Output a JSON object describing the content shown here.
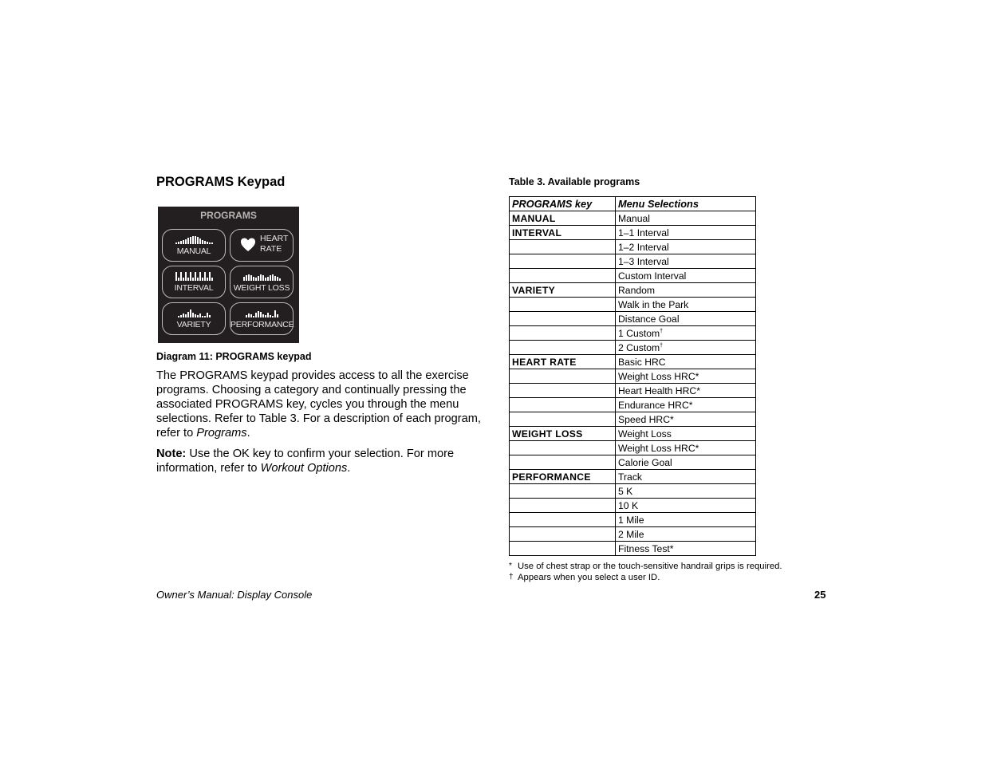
{
  "section": {
    "title": "PROGRAMS Keypad"
  },
  "keypad": {
    "title": "PROGRAMS",
    "buttons": [
      {
        "label": "MANUAL",
        "icon": "manual-profile-bars-icon"
      },
      {
        "label_line1": "HEART",
        "label_line2": "RATE",
        "icon": "heart-icon"
      },
      {
        "label": "INTERVAL",
        "icon": "interval-profile-bars-icon"
      },
      {
        "label": "WEIGHT LOSS",
        "icon": "weight-loss-profile-bars-icon"
      },
      {
        "label": "VARIETY",
        "icon": "variety-profile-bars-icon"
      },
      {
        "label": "PERFORMANCE",
        "icon": "performance-profile-bars-icon"
      }
    ],
    "colors": {
      "background": "#231f20",
      "text": "#e8e6e6"
    }
  },
  "diagram_caption": "Diagram 11: PROGRAMS keypad",
  "body": {
    "para1_text": "The PROGRAMS keypad provides access to all the exercise programs. Choosing a category and continually pressing the associated PROGRAMS key, cycles you through the menu selections. Refer to Table 3. For a description of each program, refer to ",
    "para1_link": "Programs",
    "para1_end": ".",
    "note_label": "Note:",
    "note_text": " Use the OK key to confirm your selection. For more information, refer to ",
    "note_link": "Workout Options",
    "note_end": "."
  },
  "table": {
    "title": "Table 3.  Available programs",
    "headers": [
      "PROGRAMS key",
      "Menu Selections"
    ],
    "rows": [
      {
        "key": "MANUAL",
        "selection": "Manual",
        "mark": ""
      },
      {
        "key": "INTERVAL",
        "selection": "1–1 Interval",
        "mark": ""
      },
      {
        "key": "",
        "selection": "1–2 Interval",
        "mark": ""
      },
      {
        "key": "",
        "selection": "1–3 Interval",
        "mark": ""
      },
      {
        "key": "",
        "selection": "Custom Interval",
        "mark": ""
      },
      {
        "key": "VARIETY",
        "selection": "Random",
        "mark": ""
      },
      {
        "key": "",
        "selection": "Walk in the Park",
        "mark": ""
      },
      {
        "key": "",
        "selection": "Distance Goal",
        "mark": ""
      },
      {
        "key": "",
        "selection": "1 Custom",
        "mark": "†"
      },
      {
        "key": "",
        "selection": "2 Custom",
        "mark": "†"
      },
      {
        "key": "HEART RATE",
        "selection": "Basic HRC",
        "mark": ""
      },
      {
        "key": "",
        "selection": "Weight Loss HRC*",
        "mark": ""
      },
      {
        "key": "",
        "selection": "Heart Health HRC*",
        "mark": ""
      },
      {
        "key": "",
        "selection": "Endurance HRC*",
        "mark": ""
      },
      {
        "key": "",
        "selection": "Speed HRC*",
        "mark": ""
      },
      {
        "key": "WEIGHT LOSS",
        "selection": "Weight Loss",
        "mark": ""
      },
      {
        "key": "",
        "selection": "Weight Loss HRC*",
        "mark": ""
      },
      {
        "key": "",
        "selection": "Calorie Goal",
        "mark": ""
      },
      {
        "key": "PERFORMANCE",
        "selection": "Track",
        "mark": ""
      },
      {
        "key": "",
        "selection": "5 K",
        "mark": ""
      },
      {
        "key": "",
        "selection": "10 K",
        "mark": ""
      },
      {
        "key": "",
        "selection": "1 Mile",
        "mark": ""
      },
      {
        "key": "",
        "selection": "2 Mile",
        "mark": ""
      },
      {
        "key": "",
        "selection": "Fitness Test*",
        "mark": ""
      }
    ]
  },
  "footnotes": [
    {
      "mark": "*",
      "text": "Use of chest strap or the touch-sensitive handrail grips is required."
    },
    {
      "mark": "†",
      "text": "Appears when you select a user ID."
    }
  ],
  "footer": {
    "left": "Owner’s Manual: Display Console",
    "page_number": "25"
  }
}
